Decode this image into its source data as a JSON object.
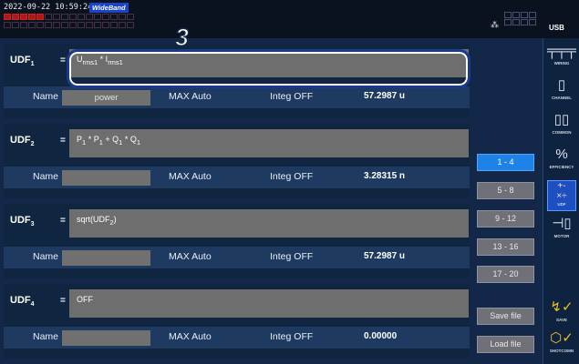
{
  "status": {
    "timestamp": "2022-09-22 10:59:24",
    "mode_badge": "WideBand",
    "usb": "USB"
  },
  "callout": "3",
  "udfs": [
    {
      "label": "UDF",
      "sub": "1",
      "eq": "=",
      "expr": "U<sub>rms1</sub> * I<sub>rms1</sub>",
      "name_label": "Name",
      "name": "power",
      "max": "MAX Auto",
      "integ": "Integ OFF",
      "value": "57.2987 u"
    },
    {
      "label": "UDF",
      "sub": "2",
      "eq": "=",
      "expr": "P<sub>1</sub> * P<sub>1</sub> + Q<sub>1</sub> * Q<sub>1</sub>",
      "name_label": "Name",
      "name": "",
      "max": "MAX Auto",
      "integ": "Integ OFF",
      "value": "3.28315 n"
    },
    {
      "label": "UDF",
      "sub": "3",
      "eq": "=",
      "expr": "sqrt(UDF<sub>2</sub>)",
      "name_label": "Name",
      "name": "",
      "max": "MAX Auto",
      "integ": "Integ OFF",
      "value": "57.2987 u"
    },
    {
      "label": "UDF",
      "sub": "4",
      "eq": "=",
      "expr": "OFF",
      "name_label": "Name",
      "name": "",
      "max": "MAX Auto",
      "integ": "Integ OFF",
      "value": "0.00000"
    }
  ],
  "range_buttons": [
    "1 - 4",
    "5 - 8",
    "9 - 12",
    "13 - 16",
    "17 - 20"
  ],
  "active_range": 0,
  "file_buttons": {
    "save": "Save file",
    "load": "Load file"
  },
  "sidebar": [
    {
      "icon": "╤╤╤",
      "label": "WIRING"
    },
    {
      "icon": "▯",
      "label": "CHANNEL"
    },
    {
      "icon": "▯▯",
      "label": "COMMON"
    },
    {
      "icon": "%",
      "label": "EFFICIENCY"
    },
    {
      "icon": "+-\n×÷",
      "label": "UDF"
    },
    {
      "icon": "⊣▯",
      "label": "MOTOR"
    },
    {
      "icon": "↯✓",
      "label": "SAVE"
    },
    {
      "icon": "⬡✓",
      "label": "SHOTCOMN"
    }
  ],
  "colors": {
    "accent": "#1e82e6",
    "highlight": "#1a3a8e"
  }
}
